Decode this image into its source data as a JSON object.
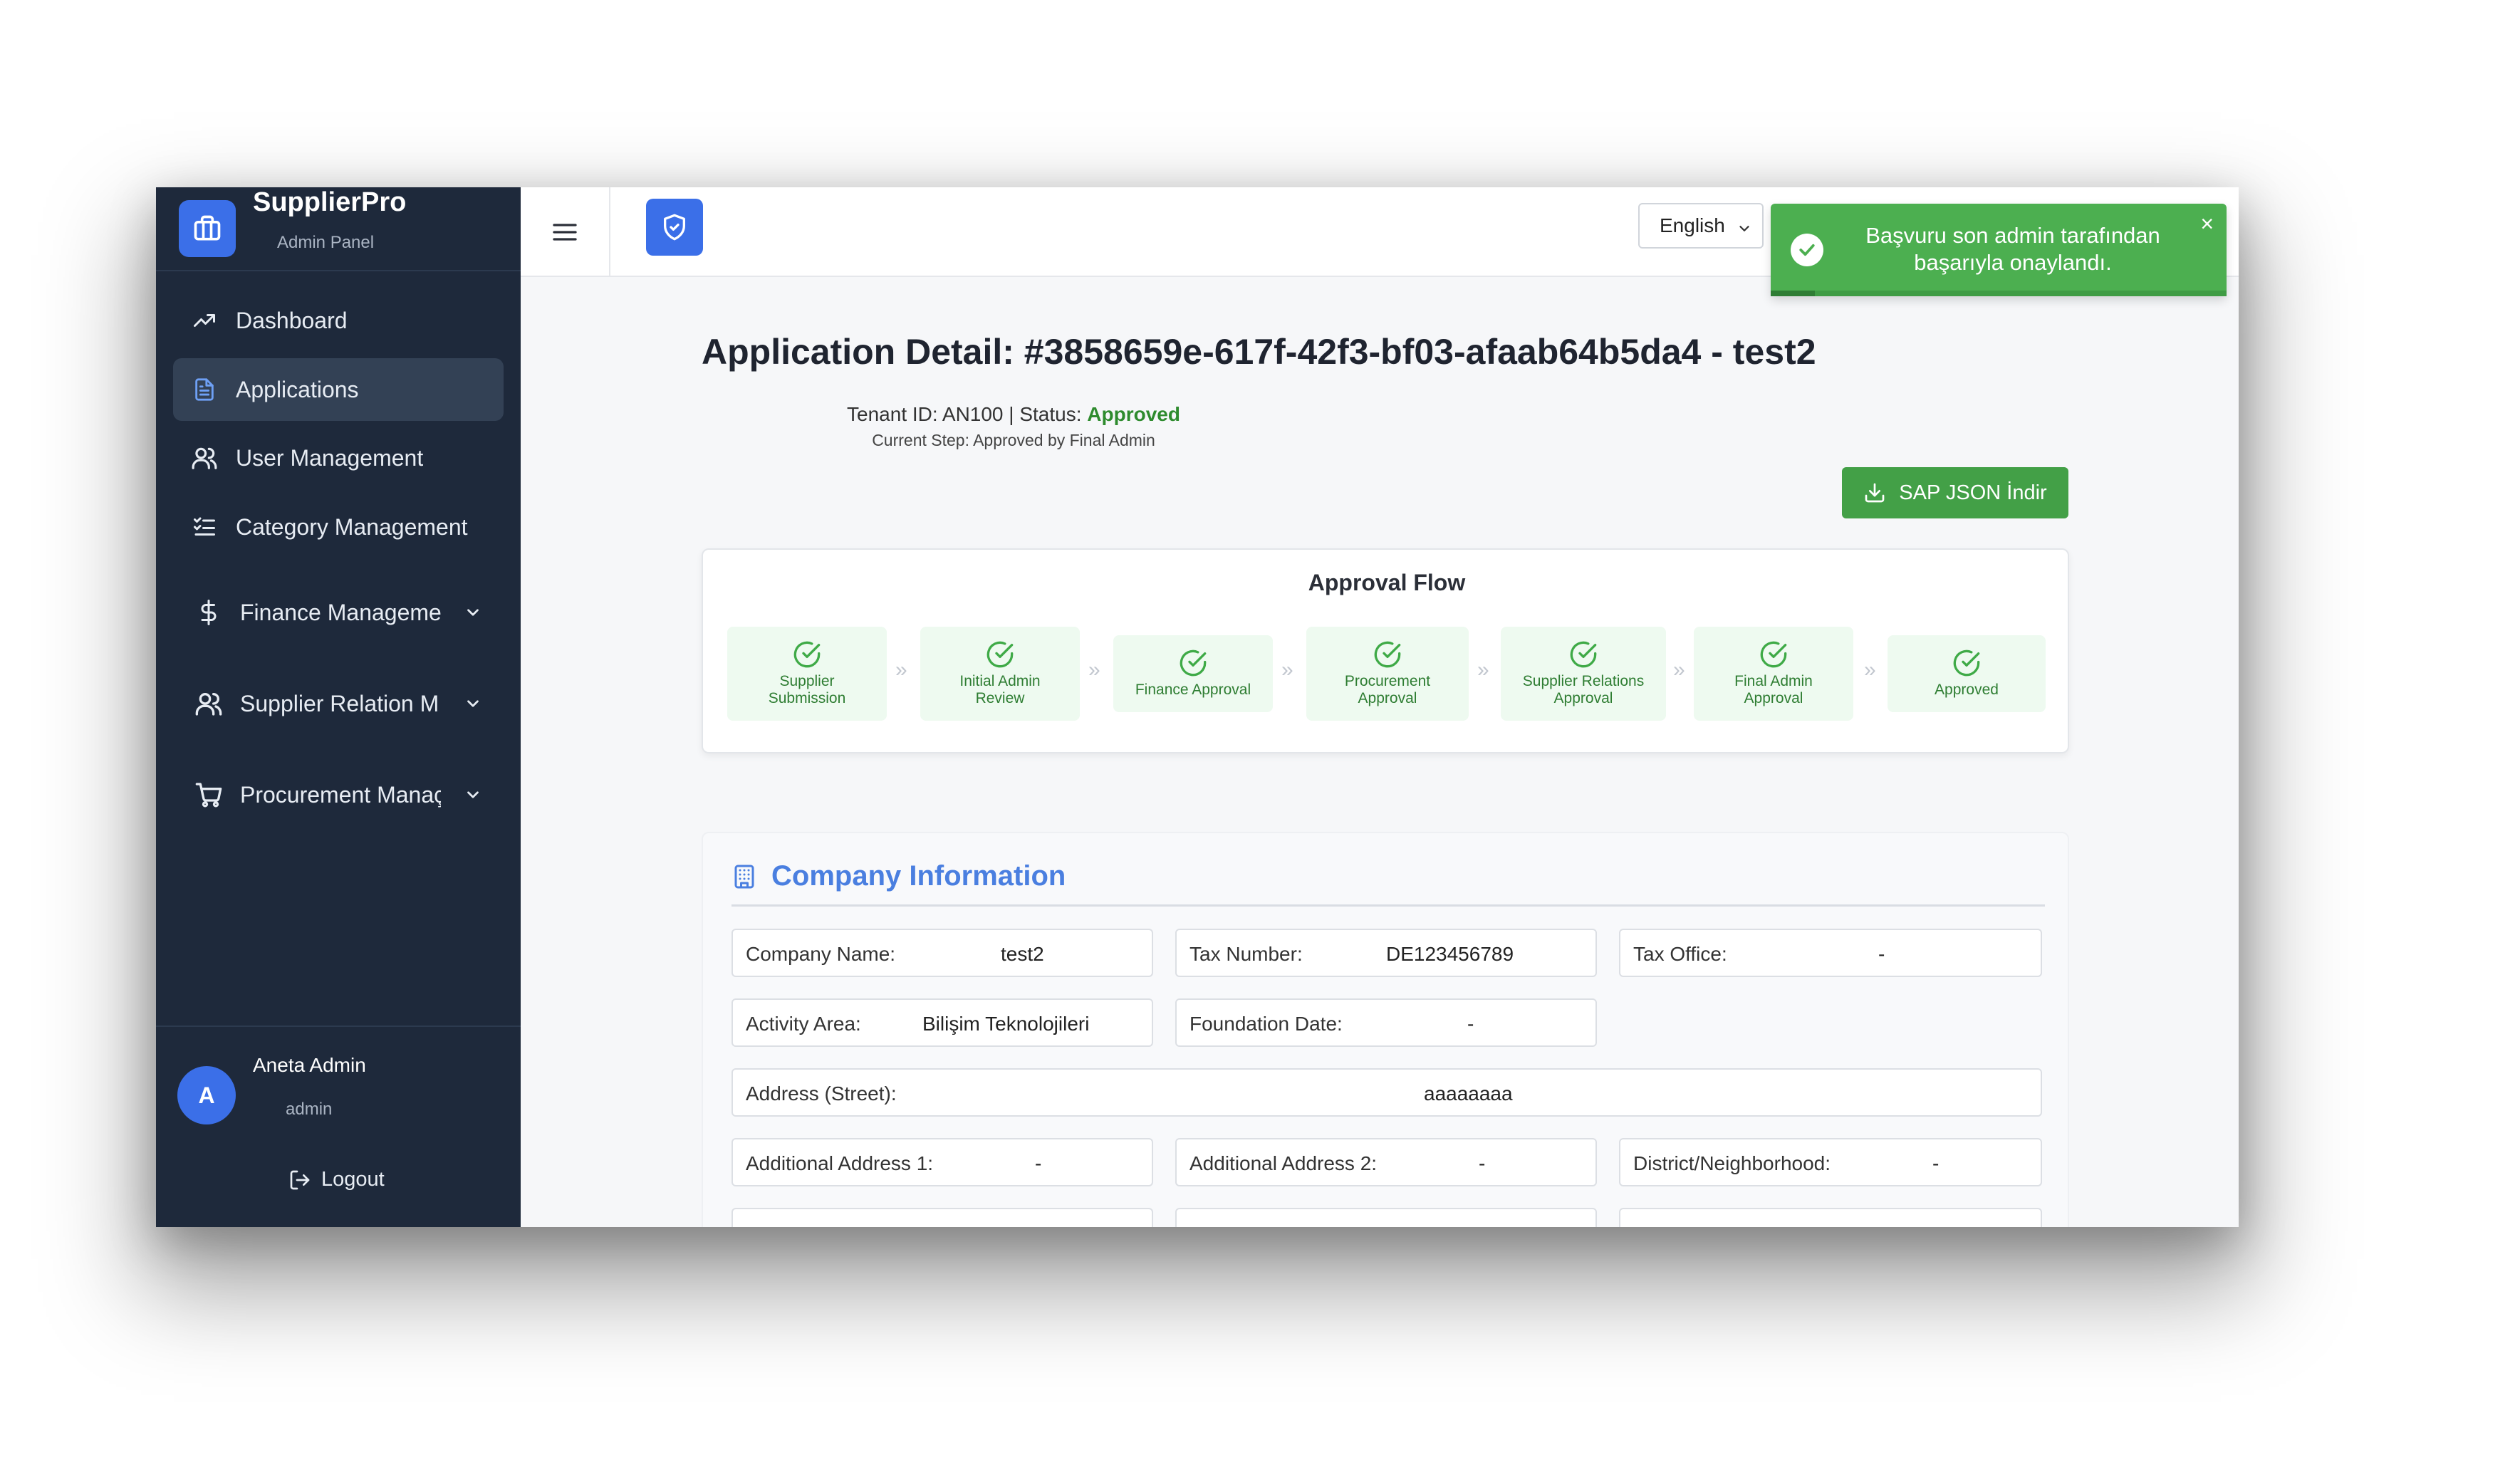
{
  "sidebar": {
    "brand_title": "SupplierPro",
    "brand_subtitle": "Admin Panel",
    "items": [
      {
        "label": "Dashboard",
        "icon": "trending-up-icon"
      },
      {
        "label": "Applications",
        "icon": "document-icon",
        "active": true
      },
      {
        "label": "User Management",
        "icon": "users-icon"
      },
      {
        "label": "Category Management",
        "icon": "list-check-icon"
      },
      {
        "label": "Finance Manageme",
        "icon": "dollar-icon"
      },
      {
        "label": "Supplier Relation M",
        "icon": "users-icon"
      },
      {
        "label": "Procurement Manaç",
        "icon": "cart-icon"
      }
    ],
    "user": {
      "initial": "A",
      "name": "Aneta Admin",
      "role": "admin"
    },
    "logout_label": "Logout"
  },
  "topbar": {
    "language": "English"
  },
  "toast": {
    "message": "Başvuru son admin tarafından başarıyla onaylandı.",
    "close": "×",
    "color": "#4caf50"
  },
  "detail": {
    "title": "Application Detail: #3858659e-617f-42f3-bf03-afaab64b5da4 - test2",
    "tenant_status_prefix": "Tenant ID: AN100 | Status: ",
    "status": "Approved",
    "current_step": "Current Step: Approved by Final Admin",
    "sap_button": "SAP JSON İndir"
  },
  "approval_flow": {
    "title": "Approval Flow",
    "steps": [
      {
        "line1": "Supplier",
        "line2": "Submission"
      },
      {
        "line1": "Initial Admin",
        "line2": "Review"
      },
      {
        "line1": "Finance Approval",
        "line2": ""
      },
      {
        "line1": "Procurement",
        "line2": "Approval"
      },
      {
        "line1": "Supplier Relations",
        "line2": "Approval"
      },
      {
        "line1": "Final Admin",
        "line2": "Approval"
      },
      {
        "line1": "Approved",
        "line2": ""
      }
    ],
    "arrow": "»",
    "step_color": "#2e7d32"
  },
  "company": {
    "heading": "Company Information",
    "fields": {
      "company_name": {
        "label": "Company Name:",
        "value": "test2"
      },
      "tax_number": {
        "label": "Tax Number:",
        "value": "DE123456789"
      },
      "tax_office": {
        "label": "Tax Office:",
        "value": "-"
      },
      "activity_area": {
        "label": "Activity Area:",
        "value": "Bilişim Teknolojileri"
      },
      "foundation_date": {
        "label": "Foundation Date:",
        "value": "-"
      },
      "address_street": {
        "label": "Address (Street):",
        "value": "aaaaaaaa"
      },
      "additional_address_1": {
        "label": "Additional Address 1:",
        "value": "-"
      },
      "additional_address_2": {
        "label": "Additional Address 2:",
        "value": "-"
      },
      "district": {
        "label": "District/Neighborhood:",
        "value": "-"
      }
    }
  }
}
